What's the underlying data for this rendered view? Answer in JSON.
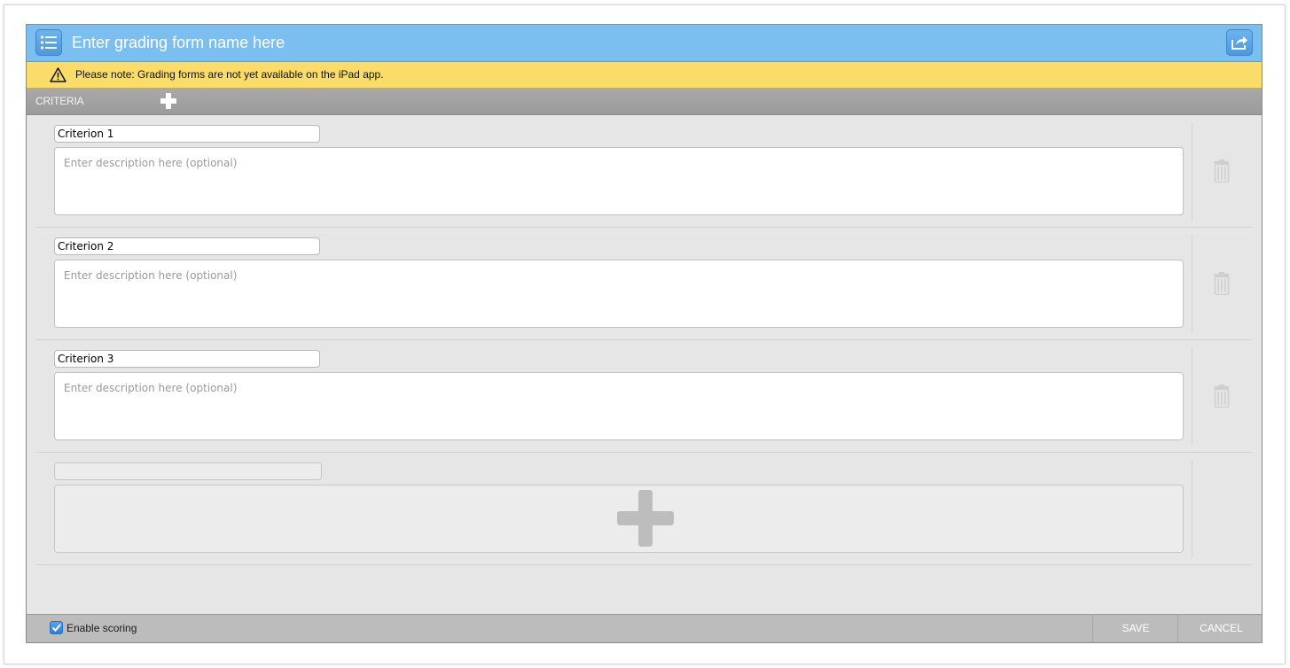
{
  "header": {
    "title": "Enter grading form name here",
    "menu_icon": "list-icon",
    "share_icon": "share-icon"
  },
  "notice": {
    "icon": "warning-icon",
    "text": "Please note: Grading forms are not yet available on the iPad app."
  },
  "criteria_bar": {
    "label": "CRITERIA",
    "add_icon": "plus-icon"
  },
  "criteria": [
    {
      "name": "Criterion 1",
      "description_placeholder": "Enter description here (optional)"
    },
    {
      "name": "Criterion 2",
      "description_placeholder": "Enter description here (optional)"
    },
    {
      "name": "Criterion 3",
      "description_placeholder": "Enter description here (optional)"
    }
  ],
  "footer": {
    "enable_scoring_label": "Enable scoring",
    "enable_scoring_checked": true,
    "save_label": "SAVE",
    "cancel_label": "CANCEL"
  },
  "colors": {
    "header": "#7bbef0",
    "notice": "#fadc6b",
    "criteria_bar": "#a3a3a3",
    "footer": "#bcbcbc",
    "content": "#e6e6e6"
  }
}
